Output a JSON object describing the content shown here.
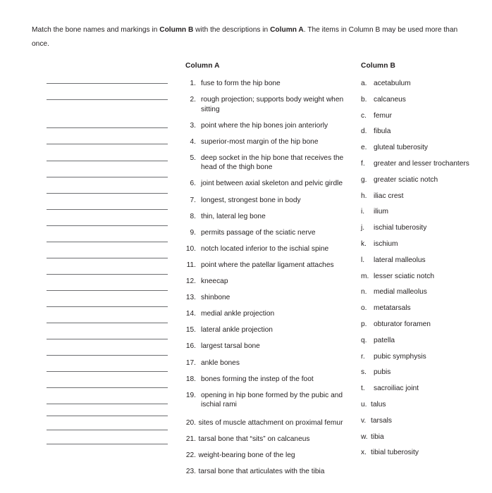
{
  "instructions": {
    "part1": "Match the bone names and markings in ",
    "bold1": "Column B",
    "part2": " with the descriptions in ",
    "bold2": "Column A",
    "part3": ". The items in Column B may be used more than once."
  },
  "column_a": {
    "header": "Column A",
    "items": [
      {
        "num": "1.",
        "text": "fuse to form the hip bone"
      },
      {
        "num": "2.",
        "text": "rough projection; supports body weight when    sitting"
      },
      {
        "num": "3.",
        "text": "point where the hip bones join anteriorly"
      },
      {
        "num": "4.",
        "text": "superior-most margin of the hip bone"
      },
      {
        "num": "5.",
        "text": "deep socket in the hip bone that receives the head of the thigh bone"
      },
      {
        "num": "6.",
        "text": "joint between axial skeleton and pelvic girdle"
      },
      {
        "num": "7.",
        "text": "longest, strongest bone in body"
      },
      {
        "num": "8.",
        "text": "thin, lateral leg bone"
      },
      {
        "num": "9.",
        "text": "permits passage of the sciatic nerve"
      },
      {
        "num": "10.",
        "text": "notch located inferior to the ischial spine"
      },
      {
        "num": "11.",
        "text": "point where the patellar ligament attaches"
      },
      {
        "num": "12.",
        "text": "kneecap"
      },
      {
        "num": "13.",
        "text": "shinbone"
      },
      {
        "num": "14.",
        "text": "medial ankle projection"
      },
      {
        "num": "15.",
        "text": "lateral ankle projection"
      },
      {
        "num": "16.",
        "text": "largest tarsal bone"
      },
      {
        "num": "17.",
        "text": "ankle bones"
      },
      {
        "num": "18.",
        "text": "bones forming the instep of the foot"
      },
      {
        "num": "19.",
        "text": "opening in hip bone formed by the pubic and ischial rami"
      },
      {
        "num": "20.",
        "text": "sites of muscle attachment on proximal femur"
      },
      {
        "num": "21.",
        "text": "tarsal bone that “sits” on calcaneus"
      },
      {
        "num": "22.",
        "text": "weight-bearing bone of the leg"
      },
      {
        "num": "23.",
        "text": "tarsal bone that articulates with the tibia"
      }
    ]
  },
  "column_b": {
    "header": "Column B",
    "items": [
      {
        "letter": "a.",
        "text": "acetabulum"
      },
      {
        "letter": "b.",
        "text": "calcaneus"
      },
      {
        "letter": "c.",
        "text": "femur"
      },
      {
        "letter": "d.",
        "text": "fibula"
      },
      {
        "letter": "e.",
        "text": "gluteal tuberosity"
      },
      {
        "letter": "f.",
        "text": "greater and lesser trochanters"
      },
      {
        "letter": "g.",
        "text": "greater sciatic notch"
      },
      {
        "letter": "h.",
        "text": "iliac crest"
      },
      {
        "letter": "i.",
        "text": "ilium"
      },
      {
        "letter": "j.",
        "text": "ischial tuberosity"
      },
      {
        "letter": "k.",
        "text": "ischium"
      },
      {
        "letter": "l.",
        "text": "lateral malleolus"
      },
      {
        "letter": "m.",
        "text": "lesser sciatic notch"
      },
      {
        "letter": "n.",
        "text": "medial malleolus"
      },
      {
        "letter": "o.",
        "text": "metatarsals"
      },
      {
        "letter": "p.",
        "text": "obturator foramen"
      },
      {
        "letter": "q.",
        "text": "patella"
      },
      {
        "letter": "r.",
        "text": "pubic symphysis"
      },
      {
        "letter": "s.",
        "text": "pubis"
      },
      {
        "letter": "t.",
        "text": "sacroiliac joint"
      },
      {
        "letter": "u.",
        "text": "talus"
      },
      {
        "letter": "v.",
        "text": "tarsals"
      },
      {
        "letter": "w.",
        "text": "tibia"
      },
      {
        "letter": "x.",
        "text": "tibial tuberosity"
      }
    ]
  },
  "answer_blanks": {
    "count": 23,
    "tops": [
      118,
      141,
      181,
      204,
      228,
      251,
      274,
      297,
      320,
      343,
      366,
      389,
      412,
      435,
      458,
      481,
      504,
      527,
      550,
      573,
      590,
      610,
      630
    ]
  }
}
